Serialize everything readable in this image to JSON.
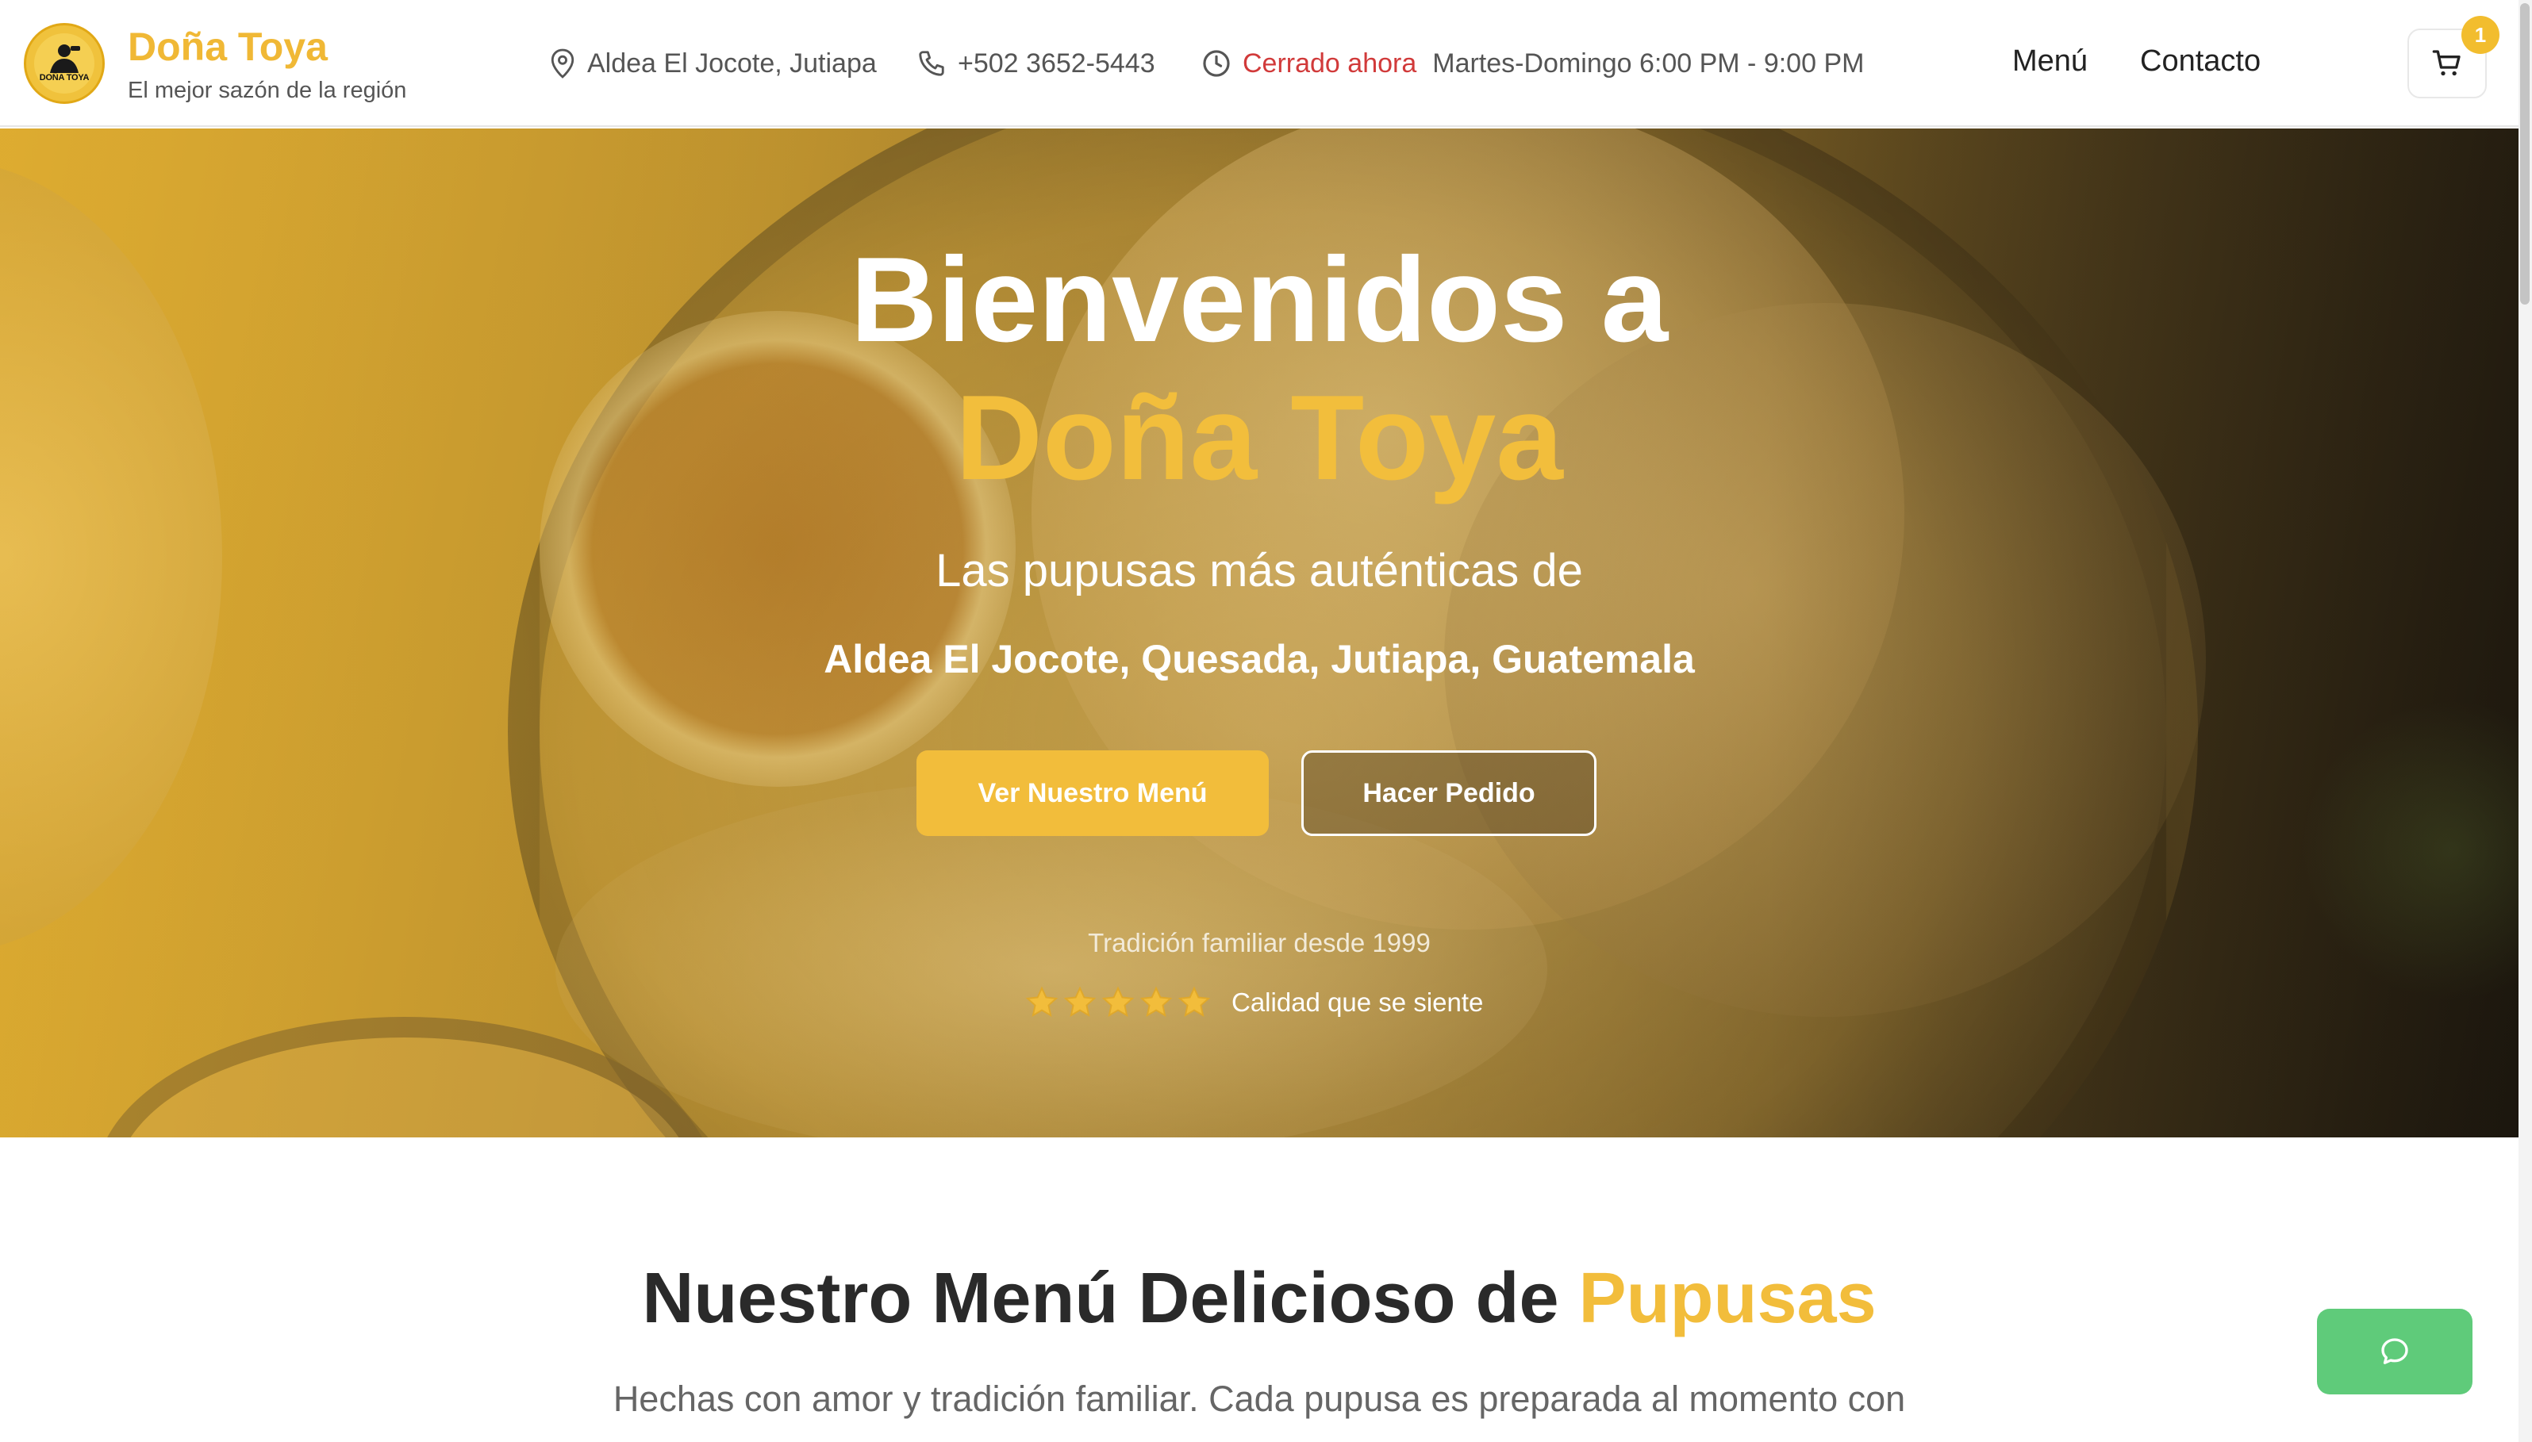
{
  "header": {
    "brand_name": "Doña Toya",
    "tagline": "El mejor sazón de la región",
    "logo_text": "DOÑA TOYA",
    "location": "Aldea El Jocote, Jutiapa",
    "phone": "+502 3652-5443",
    "status": "Cerrado ahora",
    "hours": "Martes-Domingo 6:00 PM - 9:00 PM",
    "nav": {
      "menu": "Menú",
      "contact": "Contacto"
    },
    "cart_count": "1"
  },
  "hero": {
    "title_line1": "Bienvenidos a",
    "title_line2": "Doña Toya",
    "subtitle": "Las pupusas más auténticas de",
    "location_full": "Aldea El Jocote, Quesada, Jutiapa, Guatemala",
    "primary_button": "Ver Nuestro Menú",
    "secondary_button": "Hacer Pedido",
    "tradition": "Tradición familiar desde 1999",
    "rating_stars": 5,
    "rating_text": "Calidad que se siente"
  },
  "menu_section": {
    "title_main": "Nuestro Menú Delicioso de",
    "title_accent": "Pupusas",
    "description": "Hechas con amor y tradición familiar. Cada pupusa es preparada al momento con"
  },
  "colors": {
    "accent": "#f2bd3b",
    "closed_status": "#d13a3a",
    "chat_button": "#5fcb7a"
  },
  "icons": [
    "map-pin-icon",
    "phone-icon",
    "clock-icon",
    "shopping-cart-icon",
    "star-icon",
    "chat-bubble-icon"
  ]
}
